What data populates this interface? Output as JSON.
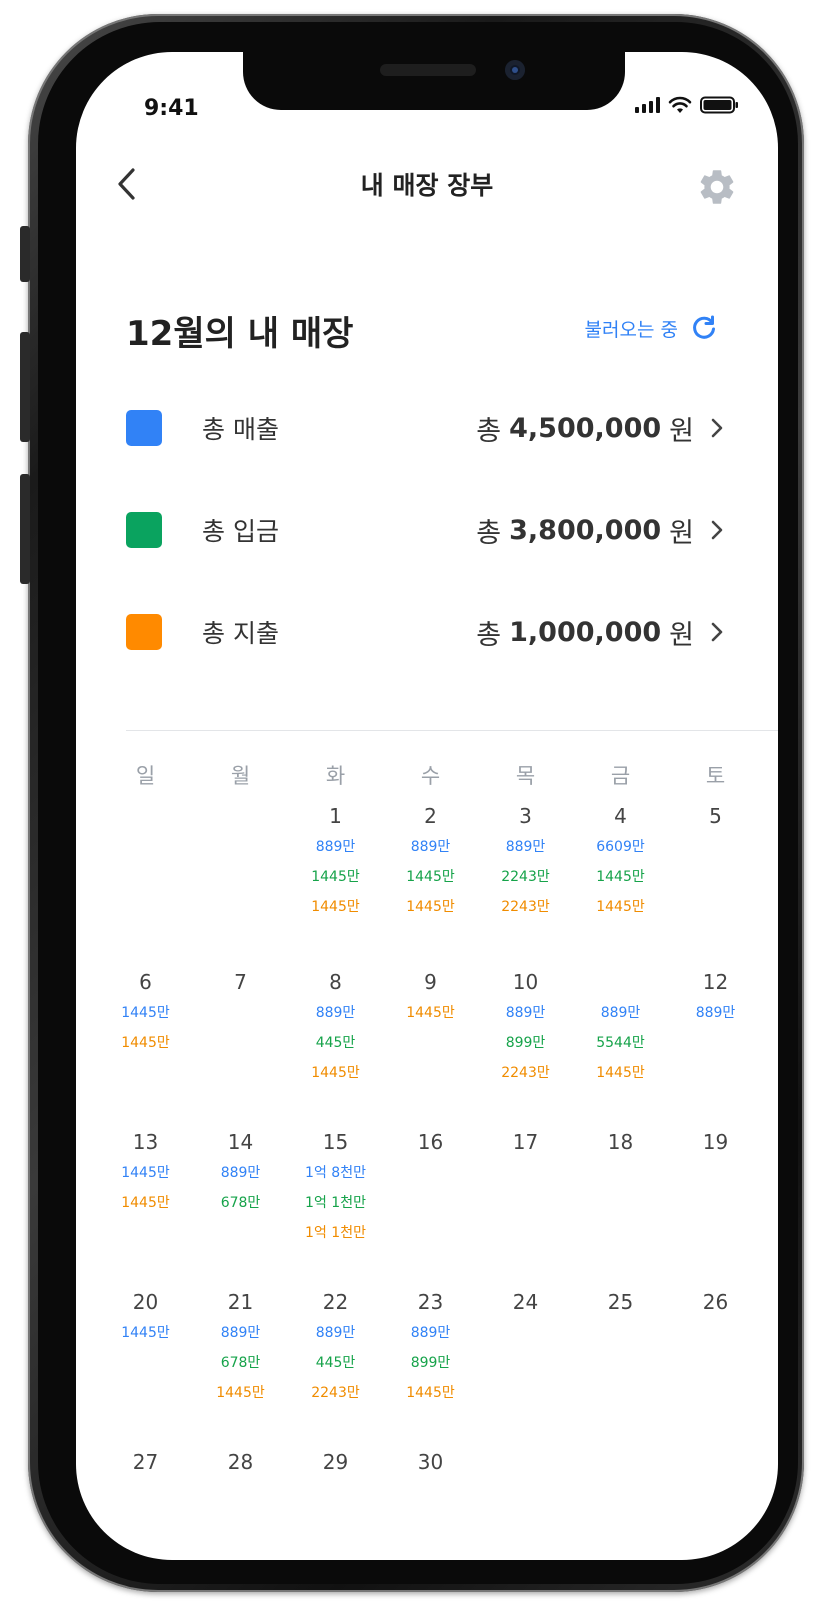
{
  "status_bar": {
    "time": "9:41"
  },
  "header": {
    "title": "내 매장 장부"
  },
  "summary": {
    "month_title": "12월의 내 매장",
    "loading_text": "불러오는 중",
    "rows": [
      {
        "label": "총 매출",
        "prefix": "총",
        "amount": "4,500,000",
        "unit": "원",
        "color": "#3182f6"
      },
      {
        "label": "총 입금",
        "prefix": "총",
        "amount": "3,800,000",
        "unit": "원",
        "color": "#0aa35f"
      },
      {
        "label": "총 지출",
        "prefix": "총",
        "amount": "1,000,000",
        "unit": "원",
        "color": "#ff8a00"
      }
    ]
  },
  "calendar": {
    "weekdays": [
      "일",
      "월",
      "화",
      "수",
      "목",
      "금",
      "토"
    ],
    "weeks": [
      [
        {
          "day": "",
          "values": []
        },
        {
          "day": "",
          "values": []
        },
        {
          "day": "1",
          "values": [
            {
              "text": "889만",
              "kind": "blue"
            },
            {
              "text": "1445만",
              "kind": "green"
            },
            {
              "text": "1445만",
              "kind": "orange"
            }
          ]
        },
        {
          "day": "2",
          "values": [
            {
              "text": "889만",
              "kind": "blue"
            },
            {
              "text": "1445만",
              "kind": "green"
            },
            {
              "text": "1445만",
              "kind": "orange"
            }
          ]
        },
        {
          "day": "3",
          "values": [
            {
              "text": "889만",
              "kind": "blue"
            },
            {
              "text": "2243만",
              "kind": "green"
            },
            {
              "text": "2243만",
              "kind": "orange"
            }
          ]
        },
        {
          "day": "4",
          "values": [
            {
              "text": "6609만",
              "kind": "blue"
            },
            {
              "text": "1445만",
              "kind": "green"
            },
            {
              "text": "1445만",
              "kind": "orange"
            }
          ]
        },
        {
          "day": "5",
          "values": []
        }
      ],
      [
        {
          "day": "6",
          "values": [
            {
              "text": "1445만",
              "kind": "blue"
            },
            {
              "text": "1445만",
              "kind": "orange"
            }
          ]
        },
        {
          "day": "7",
          "values": []
        },
        {
          "day": "8",
          "values": [
            {
              "text": "889만",
              "kind": "blue"
            },
            {
              "text": "445만",
              "kind": "green"
            },
            {
              "text": "1445만",
              "kind": "orange"
            }
          ]
        },
        {
          "day": "9",
          "values": [
            {
              "text": "1445만",
              "kind": "orange"
            }
          ]
        },
        {
          "day": "10",
          "values": [
            {
              "text": "889만",
              "kind": "blue"
            },
            {
              "text": "899만",
              "kind": "green"
            },
            {
              "text": "2243만",
              "kind": "orange"
            }
          ]
        },
        {
          "day": "",
          "values": [
            {
              "text": "889만",
              "kind": "blue"
            },
            {
              "text": "5544만",
              "kind": "green"
            },
            {
              "text": "1445만",
              "kind": "orange"
            }
          ]
        },
        {
          "day": "12",
          "values": [
            {
              "text": "889만",
              "kind": "blue"
            }
          ]
        }
      ],
      [
        {
          "day": "13",
          "values": [
            {
              "text": "1445만",
              "kind": "blue"
            },
            {
              "text": "1445만",
              "kind": "orange"
            }
          ]
        },
        {
          "day": "14",
          "values": [
            {
              "text": "889만",
              "kind": "blue"
            },
            {
              "text": "678만",
              "kind": "green"
            }
          ]
        },
        {
          "day": "15",
          "values": [
            {
              "text": "1억 8천만",
              "kind": "blue"
            },
            {
              "text": "1억 1천만",
              "kind": "green"
            },
            {
              "text": "1억 1천만",
              "kind": "orange"
            }
          ]
        },
        {
          "day": "16",
          "values": []
        },
        {
          "day": "17",
          "values": []
        },
        {
          "day": "18",
          "values": []
        },
        {
          "day": "19",
          "values": []
        }
      ],
      [
        {
          "day": "20",
          "values": [
            {
              "text": "1445만",
              "kind": "blue"
            }
          ]
        },
        {
          "day": "21",
          "values": [
            {
              "text": "889만",
              "kind": "blue"
            },
            {
              "text": "678만",
              "kind": "green"
            },
            {
              "text": "1445만",
              "kind": "orange"
            }
          ]
        },
        {
          "day": "22",
          "values": [
            {
              "text": "889만",
              "kind": "blue"
            },
            {
              "text": "445만",
              "kind": "green"
            },
            {
              "text": "2243만",
              "kind": "orange"
            }
          ]
        },
        {
          "day": "23",
          "values": [
            {
              "text": "889만",
              "kind": "blue"
            },
            {
              "text": "899만",
              "kind": "green"
            },
            {
              "text": "1445만",
              "kind": "orange"
            }
          ]
        },
        {
          "day": "24",
          "values": []
        },
        {
          "day": "25",
          "values": []
        },
        {
          "day": "26",
          "values": []
        }
      ],
      [
        {
          "day": "27",
          "values": []
        },
        {
          "day": "28",
          "values": []
        },
        {
          "day": "29",
          "values": []
        },
        {
          "day": "30",
          "values": []
        },
        {
          "day": "",
          "values": []
        },
        {
          "day": "",
          "values": []
        },
        {
          "day": "",
          "values": []
        }
      ]
    ]
  }
}
